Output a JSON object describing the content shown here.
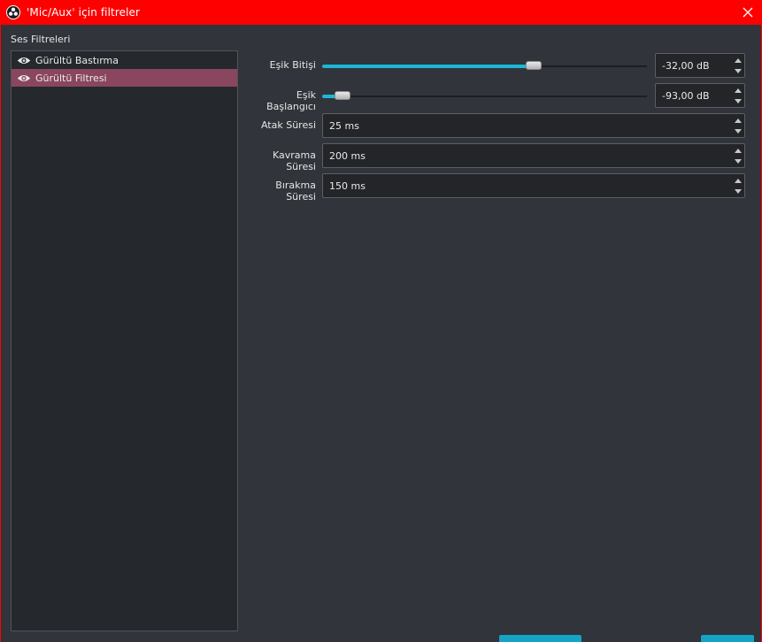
{
  "window": {
    "title": "'Mic/Aux' için filtreler",
    "accent_color": "#fe0000",
    "icons": {
      "app": "obs-logo-icon",
      "close": "close-icon"
    }
  },
  "filters_panel": {
    "label": "Ses Filtreleri",
    "items": [
      {
        "name": "Gürültü Bastırma",
        "visible": true,
        "selected": false,
        "icon": "eye-icon"
      },
      {
        "name": "Gürültü Filtresi",
        "visible": true,
        "selected": true,
        "icon": "eye-icon"
      }
    ],
    "selected_color": "#8a465e"
  },
  "properties": {
    "close_threshold": {
      "label": "Eşik Bitişi",
      "value": "-32,00 dB",
      "slider_fraction": 0.66
    },
    "open_threshold": {
      "label": "Eşik Başlangıcı",
      "value": "-93,00 dB",
      "slider_fraction": 0.04
    },
    "attack_time": {
      "label": "Atak Süresi",
      "value": "25 ms"
    },
    "hold_time": {
      "label": "Kavrama Süresi",
      "value": "200 ms"
    },
    "release_time": {
      "label": "Bırakma Süresi",
      "value": "150 ms"
    }
  },
  "colors": {
    "slider_fill": "#1db6d8",
    "button": "#16a3c5",
    "background": "#31343a"
  }
}
